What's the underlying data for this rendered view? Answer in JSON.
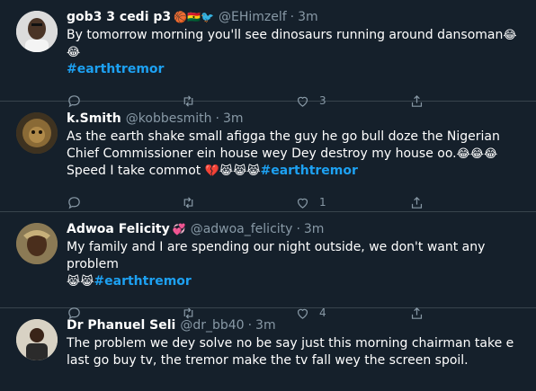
{
  "tweets": [
    {
      "name": "gob3 3 cedi p3",
      "name_emoji": "🏀🇬🇭🐦",
      "handle": "@EHimzelf",
      "time": "3m",
      "text": "By tomorrow morning you'll see dinosaurs running around dansoman",
      "text_emoji": "😂😂",
      "hashtag": "#earthtremor",
      "likes": "3",
      "retweets": "",
      "replies": ""
    },
    {
      "name": "k.Smith",
      "handle": "@kobbesmith",
      "time": "3m",
      "line1": "As the earth shake small afigga the guy he go bull doze the Nigerian Chief Commissioner ein house wey Dey destroy my house oo.",
      "line1_emoji": "😂😂😂",
      "line2": "Speed I take commot",
      "line2_emoji": "💔😹😹😹",
      "hashtag": "#earthtremor",
      "likes": "1",
      "retweets": "",
      "replies": ""
    },
    {
      "name": "Adwoa Felicity",
      "name_emoji": "💞",
      "handle": "@adwoa_felicity",
      "time": "3m",
      "text": "My family and I are spending our night outside, we don't want any problem",
      "text_emoji": "😹😹",
      "hashtag": "#earthtremor",
      "likes": "4",
      "retweets": "",
      "replies": ""
    },
    {
      "name": "Dr Phanuel Seli",
      "handle": "@dr_bb40",
      "time": "3m",
      "text": "The problem we dey solve no be say just this morning chairman take e last go buy tv, the tremor make the tv fall wey the screen spoil."
    }
  ],
  "colors": {
    "background": "#15202b",
    "secondary_text": "#8899a6",
    "accent": "#1da1f2",
    "divider": "#38444d"
  },
  "icons": [
    "reply-icon",
    "retweet-icon",
    "like-icon",
    "share-icon",
    "chevron-down-icon"
  ]
}
